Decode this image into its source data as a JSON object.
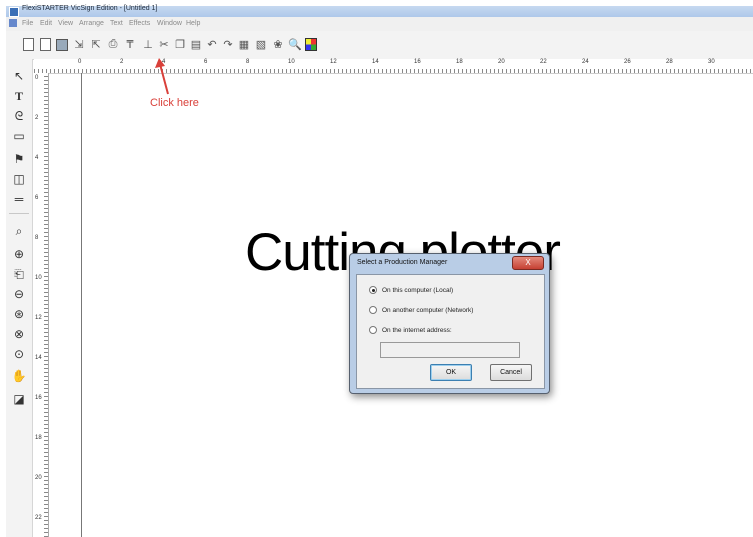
{
  "window": {
    "title": "FlexiSTARTER VicSign Edition - [Untitled 1]"
  },
  "menu": [
    "File",
    "Edit",
    "View",
    "Arrange",
    "Text",
    "Effects",
    "Window",
    "Help"
  ],
  "toolbar": {
    "icons": [
      "new-document-icon",
      "open-icon",
      "save-icon",
      "import-icon",
      "export-icon",
      "print-icon",
      "production-manager-icon",
      "cut-contour-icon",
      "cut-icon",
      "copy-icon",
      "paste-icon",
      "undo-icon",
      "redo-icon",
      "page-setup-icon",
      "properties-icon",
      "color-wheel-icon",
      "zoom-icon",
      "color-palette-icon"
    ]
  },
  "ruler": {
    "top_numbers": [
      "0",
      "2",
      "4",
      "6",
      "8",
      "10",
      "12",
      "14",
      "16",
      "18",
      "20",
      "22",
      "24",
      "26",
      "28",
      "30"
    ],
    "left_numbers": [
      "0",
      "2",
      "4",
      "6",
      "8",
      "10",
      "12",
      "14",
      "16",
      "18",
      "20",
      "22"
    ]
  },
  "canvas": {
    "design_text": "Cutting plotter"
  },
  "annotation": {
    "label": "Click here",
    "color": "#d9403a"
  },
  "dialog": {
    "title": "Select a Production Manager",
    "close_symbol": "X",
    "options": [
      {
        "label": "On this computer (Local)",
        "selected": true
      },
      {
        "label": "On another computer (Network)",
        "selected": false
      },
      {
        "label": "On the internet address:",
        "selected": false
      }
    ],
    "address_value": "",
    "ok_label": "OK",
    "cancel_label": "Cancel"
  }
}
